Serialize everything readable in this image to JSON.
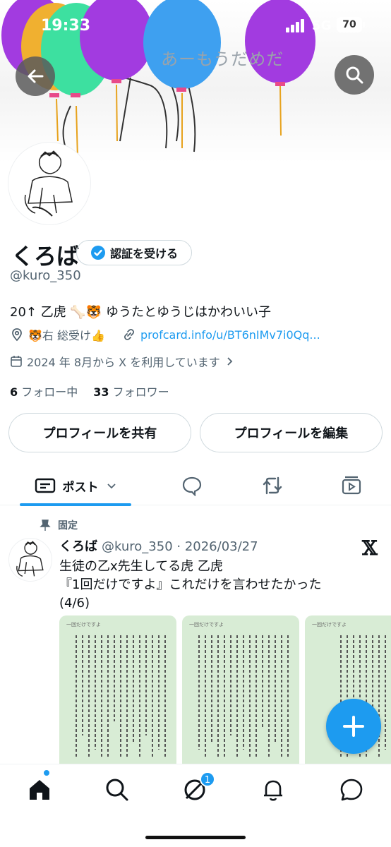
{
  "status_bar": {
    "time": "19:33",
    "network": "5G",
    "battery": "70"
  },
  "header": {
    "banner_text": "あーもうだめだ"
  },
  "profile": {
    "display_name": "くろば",
    "verify_label": "認証を受ける",
    "handle": "@kuro_350",
    "bio": "20↑ 乙虎 🦴🐯 ゆうたとゆうじはかわいい子",
    "location": "🐯右 総受け👍",
    "link": "profcard.info/u/BT6nIMv7i0Qq...",
    "joined": "2024 年 8月から X を利用しています",
    "following_count": "6",
    "following_label": "フォロー中",
    "followers_count": "33",
    "followers_label": "フォロワー",
    "share_label": "プロフィールを共有",
    "edit_label": "プロフィールを編集"
  },
  "tabs": {
    "posts_label": "ポスト"
  },
  "pinned_post": {
    "pinned_label": "固定",
    "name": "くろば",
    "handle_date": "@kuro_350 · 2026/03/27",
    "lines": [
      "生徒の乙x先生してる虎 乙虎",
      "『1回だけですよ』これだけを言わせたかった",
      "(4/6)"
    ],
    "page_titles": [
      "一回だけですよ",
      "一回だけですよ",
      "一回だけですよ"
    ]
  },
  "nav": {
    "badge_count": "1"
  },
  "colors": {
    "accent": "#1d9bf0",
    "balloon_purple": "#a23be0",
    "balloon_blue": "#3ea0f0",
    "balloon_green": "#3de0a0",
    "balloon_orange": "#f0b030"
  }
}
